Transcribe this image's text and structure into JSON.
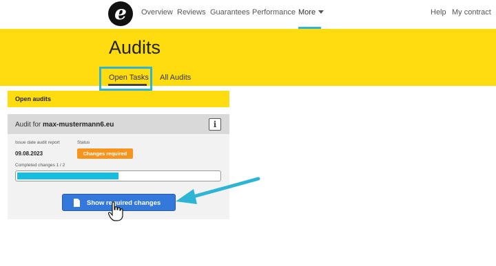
{
  "nav": {
    "logo_glyph": "e",
    "items": [
      "Overview",
      "Reviews",
      "Guarantees",
      "Performance",
      "More"
    ],
    "right_items": [
      "Help",
      "My contract"
    ],
    "accent_color": "#2eb5d6"
  },
  "header": {
    "title": "Audits",
    "tabs": [
      "Open Tasks",
      "All Audits"
    ],
    "band_color": "#ffdc0f"
  },
  "open_audits": {
    "heading": "Open audits",
    "audit": {
      "title_prefix": "Audit for ",
      "domain": "max-mustermann6.eu",
      "info_icon": "i",
      "issue_date_label": "Issue date audit report",
      "issue_date": "09.08.2023",
      "status_label": "Status",
      "status": "Changes required",
      "status_color": "#f7941d",
      "completed_label": "Completed changes 1 / 2",
      "progress": 0.5,
      "button_label": "Show required changes",
      "button_color": "#3578db"
    }
  }
}
